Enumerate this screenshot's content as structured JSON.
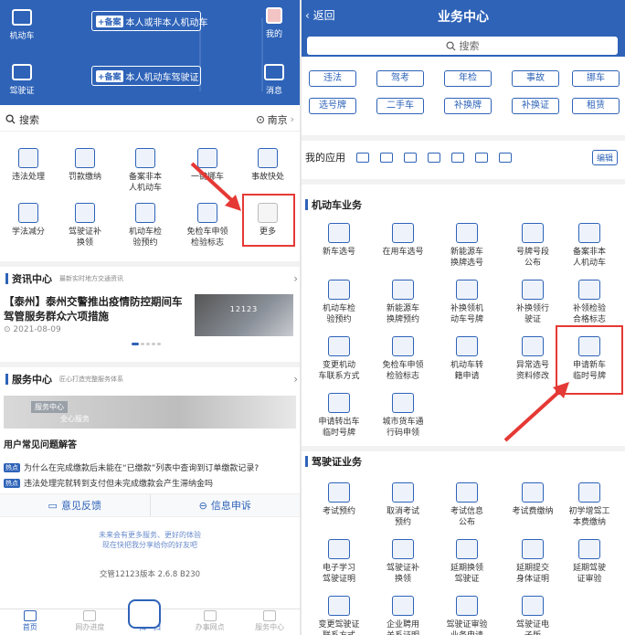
{
  "left": {
    "header": {
      "left_top_label": "机动车",
      "left_bottom_label": "驾驶证",
      "right_top_label": "我的",
      "right_bottom_label": "消息",
      "banner1": {
        "tag": "+备案",
        "text": "本人或非本人机动车"
      },
      "banner2": {
        "tag": "+备案",
        "text": "本人机动车驾驶证"
      }
    },
    "search": {
      "label": "搜索",
      "city": "南京"
    },
    "grid": [
      {
        "label": "违法处理"
      },
      {
        "label": "罚款缴纳"
      },
      {
        "label": "备案非本\n人机动车"
      },
      {
        "label": "一键挪车"
      },
      {
        "label": "事故快处"
      },
      {
        "label": "学法减分"
      },
      {
        "label": "驾驶证补\n换领"
      },
      {
        "label": "机动车检\n验预约"
      },
      {
        "label": "免检车申领\n检验标志"
      },
      {
        "label": "更多"
      }
    ],
    "news_section": {
      "title": "资讯中心",
      "subtitle": "最新实时地方交通资讯"
    },
    "news": {
      "headline": "【泰州】泰州交警推出疫情防控期间车驾管服务群众六项措施",
      "date": "2021-08-09",
      "image_text": "12123"
    },
    "service_section": {
      "title": "服务中心",
      "subtitle": "匠心打造完整服务体系"
    },
    "service_banner": {
      "badge": "服务中心",
      "text": "全心服务"
    },
    "faq_title": "用户常见问题解答",
    "faq": [
      {
        "tag": "热点",
        "text": "为什么在完成缴款后未能在“已缴款”列表中查询到订单缴款记录?"
      },
      {
        "tag": "热点",
        "text": "违法处理完就转到支付但未完成缴款会产生滞纳金吗"
      }
    ],
    "actions": {
      "feedback": "意见反馈",
      "report": "信息申诉"
    },
    "footer_note": "未来会有更多服务、更好的体验\n现在快把我分享给你的好友吧",
    "version": "交管12123版本 2.6.8 B230",
    "tabs": [
      {
        "label": "首页"
      },
      {
        "label": "网办进度"
      },
      {
        "label": "扫一扫"
      },
      {
        "label": "办事网点"
      },
      {
        "label": "服务中心"
      }
    ]
  },
  "right": {
    "header": {
      "back": "返回",
      "title": "业务中心",
      "search_placeholder": "搜索"
    },
    "chips": [
      "违法",
      "驾考",
      "年检",
      "事故",
      "挪车",
      "选号牌",
      "二手车",
      "补换牌",
      "补换证",
      "租赁"
    ],
    "my_apps": {
      "label": "我的应用",
      "edit": "编辑"
    },
    "vehicle_section": "机动车业务",
    "vehicle_items": [
      "新车选号",
      "在用车选号",
      "新能源车\n换牌选号",
      "号牌号段\n公布",
      "备案非本\n人机动车",
      "机动车检\n验预约",
      "新能源车\n换牌预约",
      "补换领机\n动车号牌",
      "补换领行\n驶证",
      "补领检验\n合格标志",
      "变更机动\n车联系方式",
      "免检车申领\n检验标志",
      "机动车转\n籍申请",
      "异常选号\n资料修改",
      "申请新车\n临时号牌",
      "申请转出车\n临时号牌",
      "城市货车通\n行码申领"
    ],
    "license_section": "驾驶证业务",
    "license_items": [
      "考试预约",
      "取消考试\n预约",
      "考试信息\n公布",
      "考试费缴纳",
      "初学增驾工\n本费缴纳",
      "电子学习\n驾驶证明",
      "驾驶证补\n换领",
      "延期换领\n驾驶证",
      "延期提交\n身体证明",
      "延期驾驶\n证审验",
      "变更驾驶证\n联系方式",
      "企业聘用\n关系证明",
      "驾驶证审验\n业务申请",
      "驾驶证电\n子版"
    ]
  }
}
